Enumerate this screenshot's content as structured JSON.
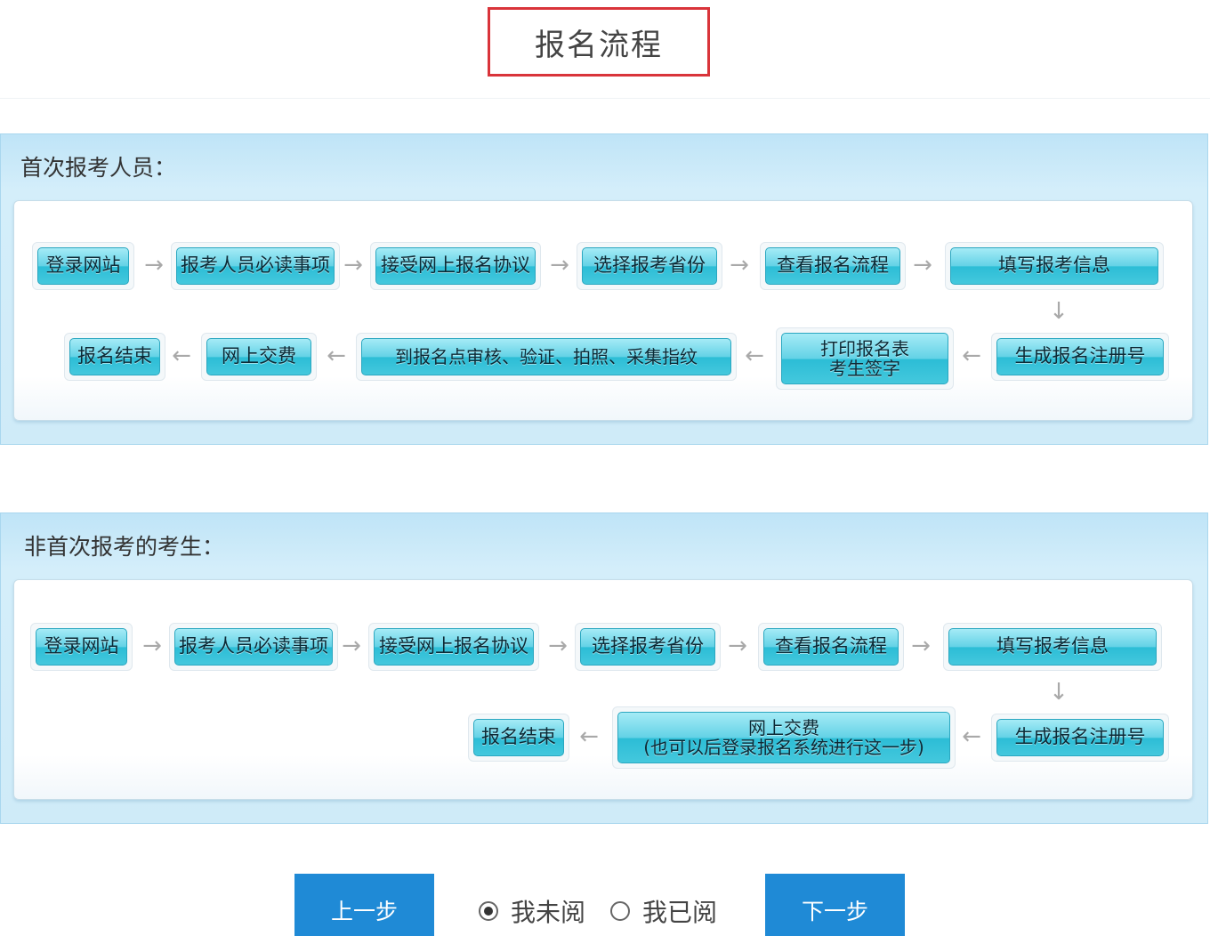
{
  "page_title": "报名流程",
  "section1": {
    "label": "首次报考人员：",
    "row1": [
      "登录网站",
      "报考人员必读事项",
      "接受网上报名协议",
      "选择报考省份",
      "查看报名流程",
      "填写报考信息"
    ],
    "row2": [
      "生成报名注册号",
      "打印报名表",
      "考生签字",
      "到报名点审核、验证、拍照、采集指纹",
      "网上交费",
      "报名结束"
    ]
  },
  "section2": {
    "label": "非首次报考的考生：",
    "row1": [
      "登录网站",
      "报考人员必读事项",
      "接受网上报名协议",
      "选择报考省份",
      "查看报名流程",
      "填写报考信息"
    ],
    "row2": [
      "生成报名注册号",
      "网上交费",
      "(也可以后登录报名系统进行这一步)",
      "报名结束"
    ]
  },
  "footer": {
    "prev": "上一步",
    "next": "下一步",
    "radio_unread": "我未阅",
    "radio_read": "我已阅",
    "selected": "我未阅"
  },
  "icons": {
    "right": "arrow-right-icon",
    "left": "arrow-left-icon",
    "down": "arrow-down-icon"
  },
  "colors": {
    "title_border": "#d9343a",
    "step_button": "#44c8dd",
    "panel": "#cfebf8",
    "nav_button": "#1f8ad6"
  }
}
